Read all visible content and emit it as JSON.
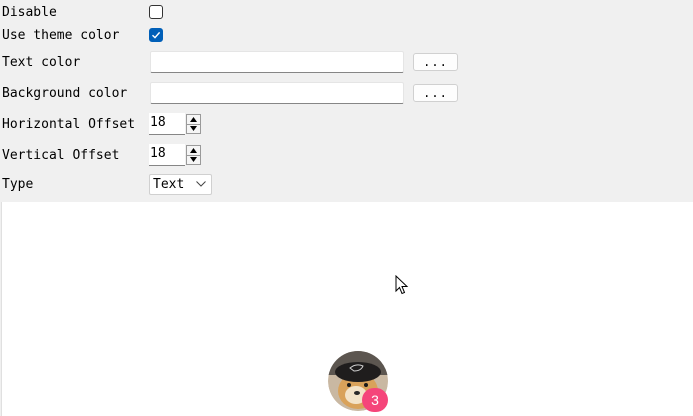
{
  "settings": {
    "disable": {
      "label": "Disable",
      "checked": false
    },
    "use_theme_color": {
      "label": "Use theme color",
      "checked": true
    },
    "text_color": {
      "label": "Text color",
      "value": "",
      "button": "..."
    },
    "background_color": {
      "label": "Background color",
      "value": "",
      "button": "..."
    },
    "horizontal_offset": {
      "label": "Horizontal Offset",
      "value": "18"
    },
    "vertical_offset": {
      "label": "Vertical Offset",
      "value": "18"
    },
    "type": {
      "label": "Type",
      "selected": "Text"
    }
  },
  "preview": {
    "badge_text": "3",
    "badge_color": "#f5457a",
    "avatar_icon": "dog-avatar-icon"
  },
  "colors": {
    "accent": "#005fb8",
    "panel_bg": "#f0f0f0",
    "preview_bg": "#ffffff"
  }
}
